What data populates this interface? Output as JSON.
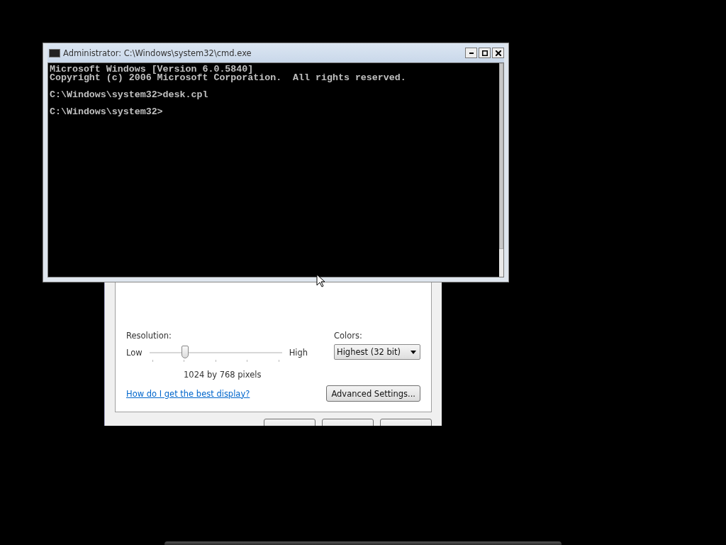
{
  "display_dialog": {
    "resolution": {
      "label": "Resolution:",
      "low": "Low",
      "high": "High",
      "level": 0.25,
      "reading": "1024 by 768 pixels"
    },
    "colors": {
      "label": "Colors:",
      "value": "Highest (32 bit)"
    },
    "help_link": "How do I get the best display?",
    "advanced_button": "Advanced Settings..."
  },
  "console": {
    "title": "Administrator: C:\\Windows\\system32\\cmd.exe",
    "blocks": [
      [
        "Microsoft Windows [Version 6.0.5840]",
        "Copyright (c) 2006 Microsoft Corporation.  All rights reserved."
      ],
      [
        "C:\\Windows\\system32>desk.cpl"
      ],
      [
        "C:\\Windows\\system32>"
      ]
    ]
  }
}
